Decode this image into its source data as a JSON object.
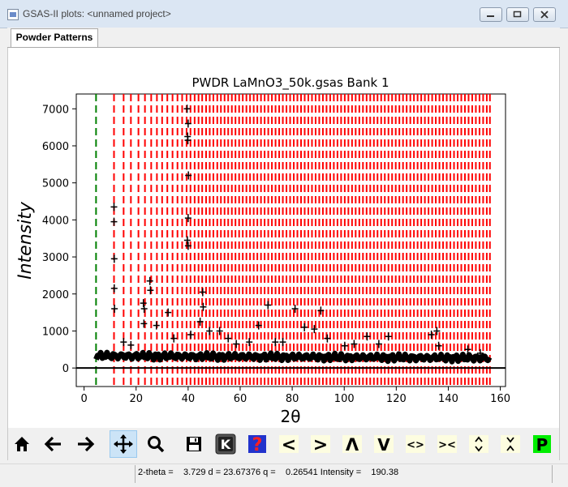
{
  "window": {
    "title": "GSAS-II plots: <unnamed project>"
  },
  "tabs": [
    {
      "label": "Powder Patterns",
      "active": true
    }
  ],
  "plot": {
    "background": "#ffffff"
  },
  "toolbar": {
    "buttons": [
      {
        "name": "home",
        "icon": "home-icon"
      },
      {
        "name": "back",
        "icon": "arrow-left-icon"
      },
      {
        "name": "forward",
        "icon": "arrow-right-icon"
      },
      {
        "name": "pan",
        "icon": "move-icon",
        "active": true
      },
      {
        "name": "zoom",
        "icon": "magnifier-icon"
      },
      {
        "name": "save",
        "icon": "floppy-icon"
      },
      {
        "name": "key-press",
        "icon": "k-key-icon",
        "label": "K"
      },
      {
        "name": "help",
        "icon": "question-icon",
        "label": "?"
      },
      {
        "name": "shift-left",
        "icon": "less-than-icon",
        "label": "<"
      },
      {
        "name": "shift-right",
        "icon": "greater-than-icon",
        "label": ">"
      },
      {
        "name": "shift-up",
        "icon": "caret-up-icon",
        "label": "Λ"
      },
      {
        "name": "shift-down",
        "icon": "v-down-icon",
        "label": "V"
      },
      {
        "name": "expand-x",
        "icon": "expand-horizontal-icon",
        "label": "<>"
      },
      {
        "name": "compress-x",
        "icon": "compress-horizontal-icon",
        "label": "><"
      },
      {
        "name": "expand-y",
        "icon": "expand-vertical-icon",
        "label": "^v"
      },
      {
        "name": "compress-y",
        "icon": "compress-vertical-icon",
        "label": "v^"
      },
      {
        "name": "publish",
        "icon": "p-publish-icon",
        "label": "P"
      }
    ]
  },
  "status": {
    "text": "2-theta =    3.729 d = 23.67376 q =    0.26541 Intensity =    190.38"
  },
  "colors": {
    "reflection_ticks": "#ff0000",
    "excluded_region": "#008000",
    "observed": "#000000",
    "zero_line": "#000000",
    "highlight": "#00ff00"
  },
  "chart_data": {
    "type": "scatter",
    "title": "PWDR LaMnO3_50k.gsas Bank 1",
    "xlabel": "2θ",
    "ylabel": "Intensity",
    "xlim": [
      -3,
      162
    ],
    "ylim": [
      -500,
      7400
    ],
    "xticks": [
      0,
      20,
      40,
      60,
      80,
      100,
      120,
      140,
      160
    ],
    "yticks": [
      0,
      1000,
      2000,
      3000,
      4000,
      5000,
      6000,
      7000
    ],
    "green_line_x": 4.6,
    "reflection_positions": [
      11.5,
      15.2,
      18.0,
      20.9,
      23.4,
      25.8,
      28.0,
      30.0,
      32.0,
      34.0,
      35.9,
      37.7,
      39.4,
      40.9,
      42.5,
      44.0,
      45.4,
      46.9,
      48.3,
      49.7,
      51.2,
      52.6,
      54.0,
      55.4,
      56.8,
      58.2,
      59.6,
      61.0,
      62.4,
      63.8,
      65.2,
      66.6,
      68.0,
      69.4,
      70.8,
      72.2,
      73.6,
      75.0,
      76.4,
      77.8,
      79.2,
      80.6,
      82.0,
      83.4,
      84.8,
      86.2,
      87.6,
      89.0,
      90.4,
      91.8,
      93.2,
      94.6,
      96.0,
      97.4,
      98.8,
      100.2,
      101.6,
      103.0,
      104.4,
      105.8,
      107.2,
      108.6,
      110.0,
      111.4,
      112.8,
      114.2,
      115.6,
      117.0,
      118.4,
      119.8,
      121.2,
      122.6,
      124.0,
      125.4,
      126.8,
      128.2,
      129.6,
      131.0,
      132.4,
      133.8,
      135.2,
      136.6,
      138.0,
      139.4,
      140.8,
      142.2,
      143.6,
      145.0,
      146.4,
      147.8,
      149.2,
      150.6,
      152.0,
      153.4,
      154.8,
      156.0
    ],
    "observed_peaks": [
      {
        "x": 11.5,
        "y": 4350
      },
      {
        "x": 11.5,
        "y": 3950
      },
      {
        "x": 11.6,
        "y": 2950
      },
      {
        "x": 11.6,
        "y": 2150
      },
      {
        "x": 11.7,
        "y": 1600
      },
      {
        "x": 15.2,
        "y": 700
      },
      {
        "x": 18.0,
        "y": 620
      },
      {
        "x": 22.8,
        "y": 1750
      },
      {
        "x": 23.1,
        "y": 1600
      },
      {
        "x": 23.0,
        "y": 1200
      },
      {
        "x": 25.3,
        "y": 2350
      },
      {
        "x": 25.5,
        "y": 2100
      },
      {
        "x": 27.8,
        "y": 1150
      },
      {
        "x": 32.3,
        "y": 1500
      },
      {
        "x": 34.5,
        "y": 800
      },
      {
        "x": 39.6,
        "y": 7000
      },
      {
        "x": 40.0,
        "y": 6600
      },
      {
        "x": 39.8,
        "y": 6250
      },
      {
        "x": 39.9,
        "y": 6150
      },
      {
        "x": 40.1,
        "y": 5200
      },
      {
        "x": 40.0,
        "y": 4050
      },
      {
        "x": 39.7,
        "y": 3450
      },
      {
        "x": 40.0,
        "y": 3300
      },
      {
        "x": 41.0,
        "y": 900
      },
      {
        "x": 44.6,
        "y": 1250
      },
      {
        "x": 45.6,
        "y": 2050
      },
      {
        "x": 45.8,
        "y": 1650
      },
      {
        "x": 48.2,
        "y": 1000
      },
      {
        "x": 52.1,
        "y": 1000
      },
      {
        "x": 55.4,
        "y": 800
      },
      {
        "x": 58.5,
        "y": 650
      },
      {
        "x": 63.5,
        "y": 700
      },
      {
        "x": 67.1,
        "y": 1150
      },
      {
        "x": 70.7,
        "y": 1700
      },
      {
        "x": 73.5,
        "y": 700
      },
      {
        "x": 76.4,
        "y": 700
      },
      {
        "x": 81.1,
        "y": 1600
      },
      {
        "x": 84.7,
        "y": 1100
      },
      {
        "x": 88.5,
        "y": 1050
      },
      {
        "x": 91.0,
        "y": 1550
      },
      {
        "x": 93.5,
        "y": 800
      },
      {
        "x": 100.2,
        "y": 600
      },
      {
        "x": 103.8,
        "y": 650
      },
      {
        "x": 108.8,
        "y": 850
      },
      {
        "x": 113.3,
        "y": 650
      },
      {
        "x": 117.0,
        "y": 850
      },
      {
        "x": 133.5,
        "y": 900
      },
      {
        "x": 135.6,
        "y": 1000
      },
      {
        "x": 136.3,
        "y": 600
      },
      {
        "x": 147.5,
        "y": 500
      },
      {
        "x": 152.3,
        "y": 400
      }
    ]
  }
}
